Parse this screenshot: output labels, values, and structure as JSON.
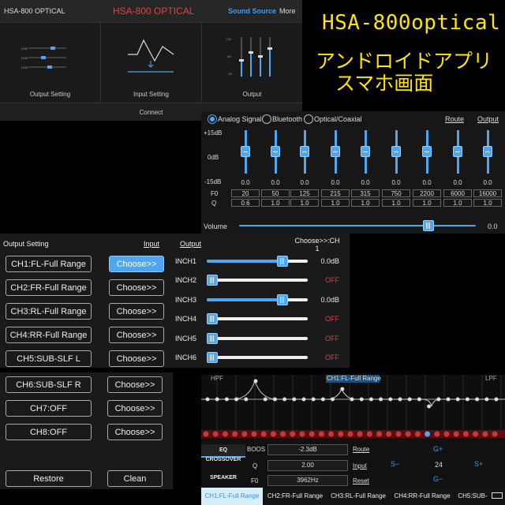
{
  "main": {
    "left_title": "HSA-800 OPTICAL",
    "center_title": "HSA-800 OPTICAL",
    "sound_source": "Sound Source",
    "more": "More",
    "cards": [
      "Output Setting",
      "Input Setting",
      "Output"
    ],
    "connect": "Connect"
  },
  "promo": {
    "line1": "HSA-800optical",
    "line2": "アンドロイドアプリ",
    "line3": "スマホ画面"
  },
  "eq": {
    "inputs": [
      "Analog Signal",
      "Bluetooth",
      "Optical/Coaxial"
    ],
    "selected_input": "Analog Signal",
    "route": "Route",
    "output": "Output",
    "db_top": "+15dB",
    "db_mid": "0dB",
    "db_bot": "-15dB",
    "f0_label": "F0",
    "q_label": "Q",
    "bands": [
      {
        "gain": "0.0",
        "f0": "20",
        "q": "0.6"
      },
      {
        "gain": "0.0",
        "f0": "50",
        "q": "1.0"
      },
      {
        "gain": "0.0",
        "f0": "125",
        "q": "1.0"
      },
      {
        "gain": "0.0",
        "f0": "215",
        "q": "1.0"
      },
      {
        "gain": "0.0",
        "f0": "315",
        "q": "1.0"
      },
      {
        "gain": "0.0",
        "f0": "750",
        "q": "1.0"
      },
      {
        "gain": "0.0",
        "f0": "2200",
        "q": "1.0"
      },
      {
        "gain": "0.0",
        "f0": "6000",
        "q": "1.0"
      },
      {
        "gain": "0.0",
        "f0": "16000",
        "q": "1.0"
      }
    ],
    "volume_label": "Volume",
    "volume_value": "0.0",
    "volume_level": 0.8
  },
  "output_setting": {
    "title": "Output Setting",
    "input_link": "Input",
    "output_link": "Output",
    "choose_ch": "Choose>>:CH 1",
    "channels": [
      "CH1:FL-Full Range",
      "CH2:FR-Full Range",
      "CH3:RL-Full Range",
      "CH4:RR-Full Range",
      "CH5:SUB-SLF L"
    ],
    "choose_label": "Choose>>",
    "inputs": [
      {
        "name": "INCH1",
        "value": "0.0dB",
        "off": false,
        "level": 0.75
      },
      {
        "name": "INCH2",
        "value": "OFF",
        "off": true,
        "level": 0.0
      },
      {
        "name": "INCH3",
        "value": "0.0dB",
        "off": false,
        "level": 0.75
      },
      {
        "name": "INCH4",
        "value": "OFF",
        "off": true,
        "level": 0.0
      },
      {
        "name": "INCH5",
        "value": "OFF",
        "off": true,
        "level": 0.0
      },
      {
        "name": "INCH6",
        "value": "OFF",
        "off": true,
        "level": 0.0
      }
    ]
  },
  "more_channels": {
    "channels": [
      "CH6:SUB-SLF R",
      "CH7:OFF",
      "CH8:OFF"
    ],
    "choose_label": "Choose>>",
    "restore": "Restore",
    "clean": "Clean"
  },
  "peq": {
    "hpf": "HPF",
    "channel": "CH1:FL-Full Range",
    "lpf": "LPF",
    "side_tabs": [
      "EQ",
      "CROSSOVER",
      "SPEAKER"
    ],
    "boost_label": "BOOS",
    "boost_value": "-2.3dB",
    "q_label": "Q",
    "q_value": "2.00",
    "f0_label": "F0",
    "f0_value": "3962Hz",
    "route": "Route",
    "input": "Input",
    "reset": "Reset",
    "g_plus": "G+",
    "g_minus": "G−",
    "s_minus": "S−",
    "s_plus": "S+",
    "step": "24",
    "tabs": [
      "CH1:FL-Full Range",
      "CH2:FR-Full Range",
      "CH3:RL-Full Range",
      "CH4:RR-Full Range",
      "CH5:SUB-"
    ],
    "accent": "#4ea6f0"
  }
}
